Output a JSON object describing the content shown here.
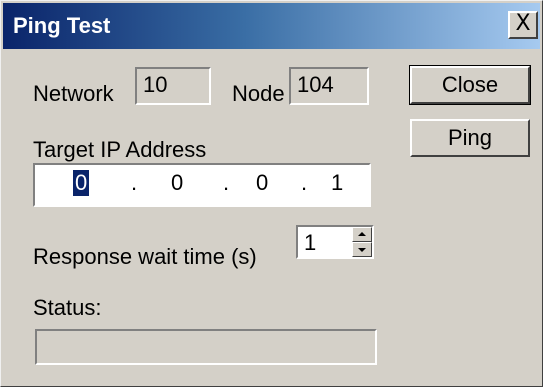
{
  "window": {
    "title": "Ping Test"
  },
  "titlebar": {
    "close_glyph": "X",
    "close_icon": "close-icon"
  },
  "form": {
    "network_label": "Network",
    "network_value": "10",
    "node_label": "Node",
    "node_value": "104",
    "target_ip_label": "Target IP Address",
    "ip_octets": [
      "0",
      "0",
      "0",
      "1"
    ],
    "ip_selected_octet": 0,
    "response_wait_label": "Response wait time (s)",
    "response_wait_value": "1",
    "status_label": "Status:",
    "status_value": ""
  },
  "buttons": {
    "close_label": "Close",
    "ping_label": "Ping"
  },
  "colors": {
    "title_gradient_start": "#0a246a",
    "title_gradient_end": "#a6caf0",
    "face": "#d4d0c8",
    "selection": "#0a246a"
  }
}
